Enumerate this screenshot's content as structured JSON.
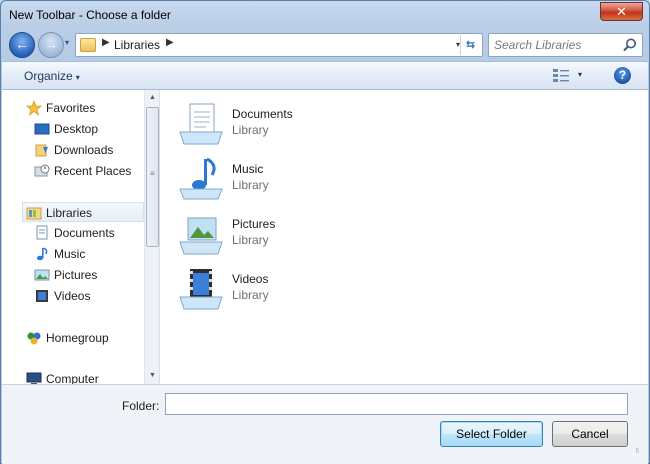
{
  "window": {
    "title": "New Toolbar - Choose a folder",
    "close_glyph": "✕"
  },
  "navbar": {
    "back_glyph": "←",
    "forward_glyph": "→",
    "history_glyph": "▾",
    "address": {
      "path": [
        "Libraries"
      ],
      "drop_glyph": "▾",
      "refresh_glyph": "⇆"
    },
    "search": {
      "placeholder": "Search Libraries",
      "value": ""
    }
  },
  "toolbar": {
    "organize_label": "Organize",
    "caret": "▾",
    "views_caret": "▾",
    "help_glyph": "?"
  },
  "nav_pane": {
    "favorites": {
      "label": "Favorites",
      "items": [
        {
          "label": "Desktop"
        },
        {
          "label": "Downloads"
        },
        {
          "label": "Recent Places"
        }
      ]
    },
    "libraries": {
      "label": "Libraries",
      "items": [
        {
          "label": "Documents"
        },
        {
          "label": "Music"
        },
        {
          "label": "Pictures"
        },
        {
          "label": "Videos"
        }
      ]
    },
    "homegroup": {
      "label": "Homegroup"
    },
    "computer": {
      "label": "Computer"
    },
    "scroll": {
      "up_glyph": "▲",
      "down_glyph": "▼"
    }
  },
  "libraries": [
    {
      "name": "Documents",
      "type": "Library",
      "icon": "documents-library-icon"
    },
    {
      "name": "Music",
      "type": "Library",
      "icon": "music-library-icon"
    },
    {
      "name": "Pictures",
      "type": "Library",
      "icon": "pictures-library-icon"
    },
    {
      "name": "Videos",
      "type": "Library",
      "icon": "videos-library-icon"
    }
  ],
  "footer": {
    "folder_label": "Folder:",
    "folder_value": "",
    "select_label": "Select Folder",
    "cancel_label": "Cancel"
  },
  "colors": {
    "accent": "#2560b8",
    "selection": "#e6eef8"
  }
}
